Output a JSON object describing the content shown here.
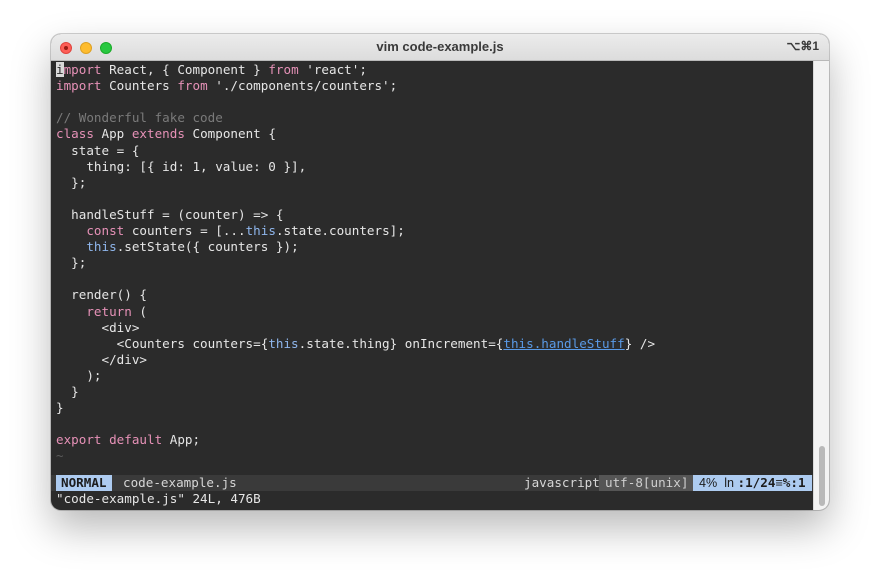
{
  "window": {
    "title": "vim code-example.js",
    "shortcut": "⌥⌘1"
  },
  "editor": {
    "lines": [
      {
        "parts": [
          [
            "cursor",
            "i"
          ],
          [
            "kw",
            "mport"
          ],
          [
            "txt",
            " React, { Component } "
          ],
          [
            "kw",
            "from"
          ],
          [
            "str",
            " 'react';"
          ]
        ]
      },
      {
        "parts": [
          [
            "kw",
            "import"
          ],
          [
            "txt",
            " Counters "
          ],
          [
            "kw",
            "from"
          ],
          [
            "str",
            " './components/counters';"
          ]
        ]
      },
      {
        "parts": []
      },
      {
        "parts": [
          [
            "cm",
            "// Wonderful fake code"
          ]
        ]
      },
      {
        "parts": [
          [
            "kw",
            "class"
          ],
          [
            "txt",
            " App "
          ],
          [
            "kw",
            "extends"
          ],
          [
            "txt",
            " Component {"
          ]
        ]
      },
      {
        "parts": [
          [
            "txt",
            "  state = {"
          ]
        ]
      },
      {
        "parts": [
          [
            "txt",
            "    thing: [{ id: 1, value: 0 }],"
          ]
        ]
      },
      {
        "parts": [
          [
            "txt",
            "  };"
          ]
        ]
      },
      {
        "parts": []
      },
      {
        "parts": [
          [
            "txt",
            "  handleStuff = (counter) => {"
          ]
        ]
      },
      {
        "parts": [
          [
            "txt",
            "    "
          ],
          [
            "kw",
            "const"
          ],
          [
            "txt",
            " counters = [..."
          ],
          [
            "th",
            "this"
          ],
          [
            "txt",
            ".state.counters];"
          ]
        ]
      },
      {
        "parts": [
          [
            "txt",
            "    "
          ],
          [
            "th",
            "this"
          ],
          [
            "txt",
            ".setState({ counters });"
          ]
        ]
      },
      {
        "parts": [
          [
            "txt",
            "  };"
          ]
        ]
      },
      {
        "parts": []
      },
      {
        "parts": [
          [
            "txt",
            "  render() {"
          ]
        ]
      },
      {
        "parts": [
          [
            "txt",
            "    "
          ],
          [
            "kw",
            "return"
          ],
          [
            "txt",
            " ("
          ]
        ]
      },
      {
        "parts": [
          [
            "txt",
            "      <div>"
          ]
        ]
      },
      {
        "parts": [
          [
            "txt",
            "        <Counters counters={"
          ],
          [
            "th",
            "this"
          ],
          [
            "txt",
            ".state.thing} onIncrement={"
          ],
          [
            "link",
            "this.handleStuff"
          ],
          [
            "txt",
            "} />"
          ]
        ]
      },
      {
        "parts": [
          [
            "txt",
            "      </div>"
          ]
        ]
      },
      {
        "parts": [
          [
            "txt",
            "    );"
          ]
        ]
      },
      {
        "parts": [
          [
            "txt",
            "  }"
          ]
        ]
      },
      {
        "parts": [
          [
            "txt",
            "}"
          ]
        ]
      },
      {
        "parts": []
      },
      {
        "parts": [
          [
            "kw",
            "export"
          ],
          [
            "txt",
            " "
          ],
          [
            "kw",
            "default"
          ],
          [
            "txt",
            " App;"
          ]
        ]
      },
      {
        "parts": [
          [
            "tilde",
            "~"
          ]
        ]
      }
    ]
  },
  "statusline": {
    "mode": "NORMAL",
    "filename": "code-example.js",
    "filetype": "javascript",
    "encoding": "utf-8[unix]",
    "percent": "4%",
    "ln_label": "ln",
    "position": ":1/24",
    "col_icon": "≡",
    "col": "%:1"
  },
  "cmdline": {
    "message": "\"code-example.js\" 24L, 476B"
  },
  "colors": {
    "background": "#2b2b2b",
    "keyword": "#e691b7",
    "comment": "#7a7a7a",
    "this": "#8fb6ec",
    "statusline_accent": "#adcbf0"
  }
}
